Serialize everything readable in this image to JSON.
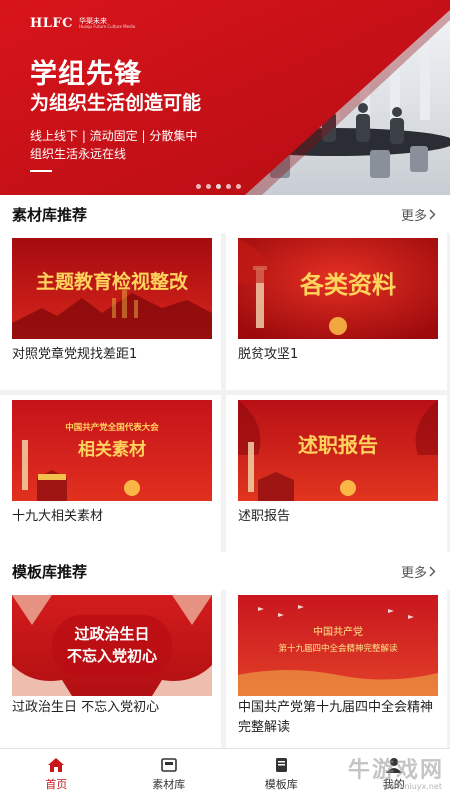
{
  "banner": {
    "logo_main": "HLFC",
    "logo_cn": "华渠未来",
    "logo_en": "Huaqu Future Culture Media",
    "title": "学组先锋",
    "subtitle": "为组织生活创造可能",
    "line1": "线上线下 | 流动固定 | 分散集中",
    "line2": "组织生活永远在线"
  },
  "materials": {
    "title": "素材库推荐",
    "more": "更多",
    "items": [
      {
        "thumb_text": "主题教育检视整改",
        "label": "对照党章党规找差距1"
      },
      {
        "thumb_text": "各类资料",
        "label": "脱贫攻坚1"
      },
      {
        "thumb_text_top": "中国共产党全国代表大会",
        "thumb_text": "相关素材",
        "label": "十九大相关素材"
      },
      {
        "thumb_text": "述职报告",
        "label": "述职报告"
      }
    ]
  },
  "templates": {
    "title": "模板库推荐",
    "more": "更多",
    "items": [
      {
        "thumb_text_1": "过政治生日",
        "thumb_text_2": "不忘入党初心",
        "label": "过政治生日 不忘入党初心"
      },
      {
        "thumb_text_1": "中国共产党",
        "thumb_text_2": "第十九届四中全会精神完整解读",
        "label": "中国共产党第十九届四中全会精神完整解读"
      }
    ]
  },
  "tabs": [
    {
      "label": "首页",
      "icon": "home-icon",
      "active": true
    },
    {
      "label": "素材库",
      "icon": "material-icon",
      "active": false
    },
    {
      "label": "模板库",
      "icon": "template-icon",
      "active": false
    },
    {
      "label": "我的",
      "icon": "user-icon",
      "active": false
    }
  ],
  "watermark": {
    "text": "牛游戏网",
    "url": "www.niuyx.net"
  },
  "colors": {
    "primary": "#c8161d",
    "text": "#222222",
    "background": "#f2f2f2"
  }
}
